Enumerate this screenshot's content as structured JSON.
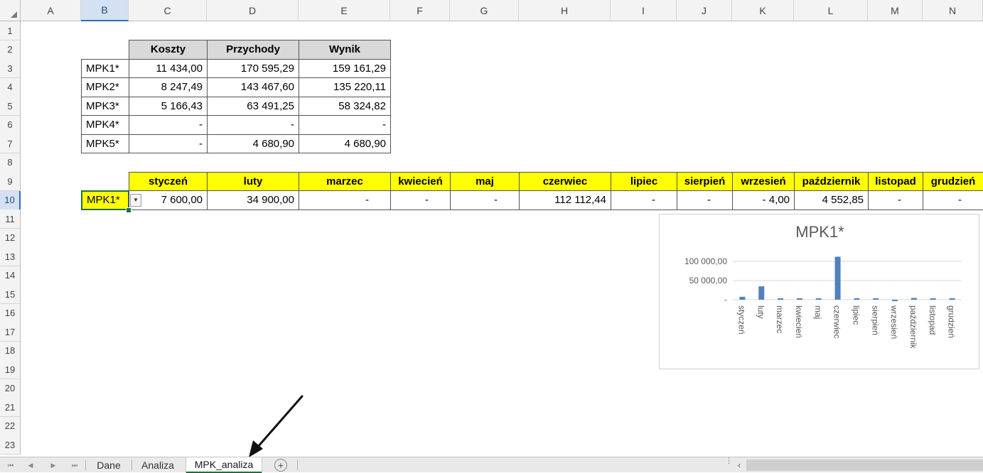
{
  "columns": [
    "A",
    "B",
    "C",
    "D",
    "E",
    "F",
    "G",
    "H",
    "I",
    "J",
    "K",
    "L",
    "M",
    "N"
  ],
  "rows": [
    "1",
    "2",
    "3",
    "4",
    "5",
    "6",
    "7",
    "8",
    "9",
    "10",
    "11",
    "12",
    "13",
    "14",
    "15",
    "16",
    "17",
    "18",
    "19",
    "20",
    "21",
    "22",
    "23"
  ],
  "summary_table": {
    "headers": [
      "Koszty",
      "Przychody",
      "Wynik"
    ],
    "rows": [
      {
        "label": "MPK1*",
        "values": [
          "11 434,00",
          "170 595,29",
          "159 161,29"
        ]
      },
      {
        "label": "MPK2*",
        "values": [
          "8 247,49",
          "143 467,60",
          "135 220,11"
        ]
      },
      {
        "label": "MPK3*",
        "values": [
          "5 166,43",
          "63 491,25",
          "58 324,82"
        ]
      },
      {
        "label": "MPK4*",
        "values": [
          "-",
          "-",
          "-"
        ]
      },
      {
        "label": "MPK5*",
        "values": [
          "-",
          "4 680,90",
          "4 680,90"
        ]
      }
    ]
  },
  "monthly_table": {
    "months": [
      "styczeń",
      "luty",
      "marzec",
      "kwiecień",
      "maj",
      "czerwiec",
      "lipiec",
      "sierpień",
      "wrzesień",
      "październik",
      "listopad",
      "grudzień"
    ],
    "selector_value": "MPK1*",
    "values": [
      "7 600,00",
      "34 900,00",
      "-",
      "-",
      "-",
      "112 112,44",
      "-",
      "-",
      "- 4,00",
      "4 552,85",
      "-",
      "-"
    ]
  },
  "chart_data": {
    "type": "bar",
    "title": "MPK1*",
    "categories": [
      "styczeń",
      "luty",
      "marzec",
      "kwiecień",
      "maj",
      "czerwiec",
      "lipiec",
      "sierpień",
      "wrzesień",
      "październik",
      "listopad",
      "grudzień"
    ],
    "values": [
      7600.0,
      34900.0,
      0,
      0,
      0,
      112112.44,
      0,
      0,
      -4.0,
      4552.85,
      0,
      0
    ],
    "ytick_labels": [
      "-",
      "50 000,00",
      "100 000,00"
    ],
    "ylim": [
      0,
      100000
    ],
    "grid": true,
    "legend": "none",
    "bar_color": "#4f81bd"
  },
  "sheet_tabs": [
    {
      "label": "Dane",
      "active": false
    },
    {
      "label": "Analiza",
      "active": false
    },
    {
      "label": "MPK_analiza",
      "active": true
    }
  ],
  "colors": {
    "header_gray": "#d9d9d9",
    "header_yellow": "#ffff00",
    "selection": "#1f6f3f"
  },
  "icons": {
    "add_sheet": "plus-circle-icon",
    "dropdown": "chevron-down-icon"
  }
}
